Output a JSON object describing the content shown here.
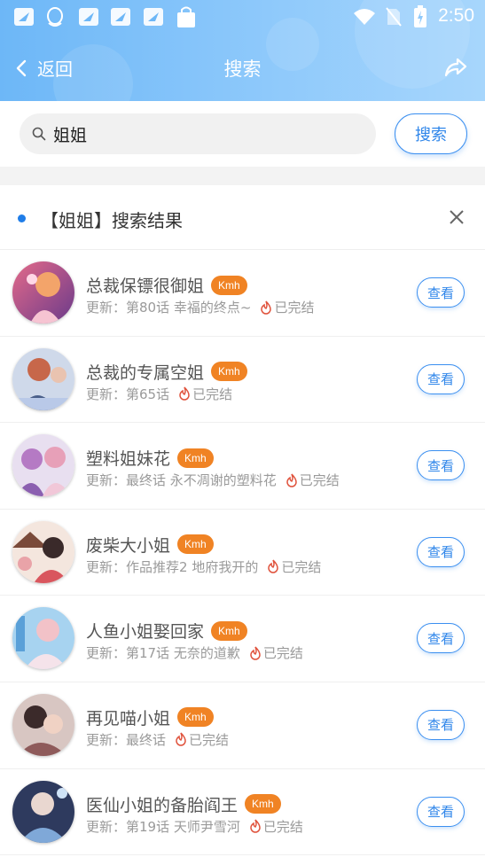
{
  "status_bar": {
    "time": "2:50",
    "left_icons": [
      "app-notification-icon",
      "qq-notification-icon",
      "app-notification-icon",
      "app-notification-icon",
      "app-notification-icon",
      "bag-icon"
    ],
    "right_icons": [
      "wifi-icon",
      "no-sim-icon",
      "battery-charging-icon"
    ]
  },
  "navbar": {
    "back_label": "返回",
    "title": "搜索",
    "share_icon": "share-icon"
  },
  "search": {
    "value": "姐姐",
    "button_label": "搜索"
  },
  "results": {
    "header": "【姐姐】搜索结果",
    "items": [
      {
        "title": "总裁保镖很御姐",
        "badge": "Kmh",
        "update_prefix": "更新：",
        "latest": "第80话 幸福的终点~",
        "status": "已完结",
        "button": "查看"
      },
      {
        "title": "总裁的专属空姐",
        "badge": "Kmh",
        "update_prefix": "更新：",
        "latest": "第65话",
        "status": "已完结",
        "button": "查看"
      },
      {
        "title": "塑料姐妹花",
        "badge": "Kmh",
        "update_prefix": "更新：",
        "latest": "最终话 永不凋谢的塑料花",
        "status": "已完结",
        "button": "查看"
      },
      {
        "title": "废柴大小姐",
        "badge": "Kmh",
        "update_prefix": "更新：",
        "latest": "作品推荐2 地府我开的",
        "status": "已完结",
        "button": "查看"
      },
      {
        "title": "人鱼小姐娶回家",
        "badge": "Kmh",
        "update_prefix": "更新：",
        "latest": "第17话 无奈的道歉",
        "status": "已完结",
        "button": "查看"
      },
      {
        "title": "再见喵小姐",
        "badge": "Kmh",
        "update_prefix": "更新：",
        "latest": "最终话",
        "status": "已完结",
        "button": "查看"
      },
      {
        "title": "医仙小姐的备胎阎王",
        "badge": "Kmh",
        "update_prefix": "更新：",
        "latest": "第19话 天师尹雪河",
        "status": "已完结",
        "button": "查看"
      }
    ]
  },
  "colors": {
    "header_gradient_start": "#6db7f7",
    "header_gradient_end": "#a7d6fc",
    "accent_blue": "#2f86ea",
    "badge_orange": "#f08324",
    "status_red": "#e0533d"
  }
}
